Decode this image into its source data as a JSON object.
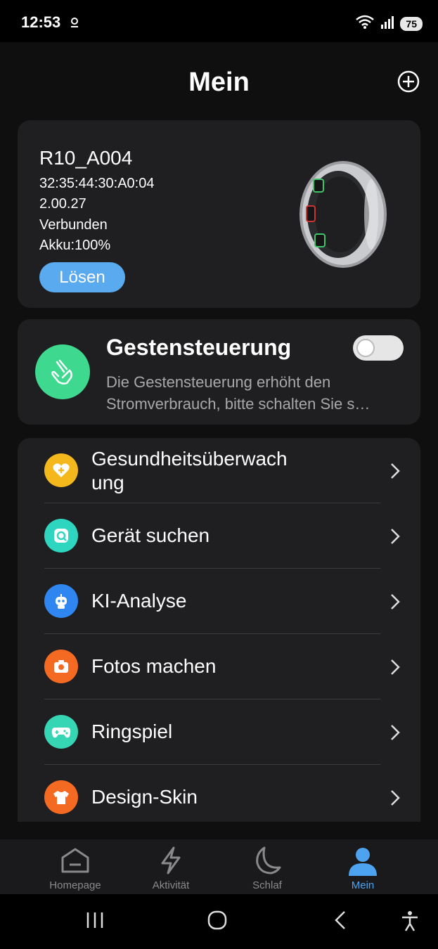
{
  "status_bar": {
    "time": "12:53",
    "battery": "75"
  },
  "header": {
    "title": "Mein"
  },
  "device": {
    "name": "R10_A004",
    "mac": "32:35:44:30:A0:04",
    "version": "2.00.27",
    "status": "Verbunden",
    "battery": "Akku:100%",
    "disconnect_label": "Lösen"
  },
  "gesture": {
    "title": "Gestensteuerung",
    "description": "Die Gestensteuerung erhöht den Stromverbrauch, bitte schalten Sie s…",
    "enabled": false
  },
  "menu": [
    {
      "label": "Gesundheitsüberwach\nung",
      "icon": "heart-plus-icon",
      "color": "#f5b81c"
    },
    {
      "label": "Gerät suchen",
      "icon": "search-device-icon",
      "color": "#2ed6c0"
    },
    {
      "label": "KI-Analyse",
      "icon": "robot-icon",
      "color": "#2f86f0"
    },
    {
      "label": "Fotos machen",
      "icon": "camera-icon",
      "color": "#f56a22"
    },
    {
      "label": "Ringspiel",
      "icon": "gamepad-icon",
      "color": "#36d6b4"
    },
    {
      "label": "Design-Skin",
      "icon": "tshirt-icon",
      "color": "#f56a22"
    }
  ],
  "tabs": [
    {
      "label": "Homepage",
      "icon": "home-icon",
      "active": false
    },
    {
      "label": "Aktivität",
      "icon": "lightning-icon",
      "active": false
    },
    {
      "label": "Schlaf",
      "icon": "moon-icon",
      "active": false
    },
    {
      "label": "Mein",
      "icon": "person-icon",
      "active": true
    }
  ],
  "colors": {
    "accent": "#4da3f0",
    "disconnect_button": "#5aaaf0",
    "gesture_green": "#3ed98f"
  }
}
